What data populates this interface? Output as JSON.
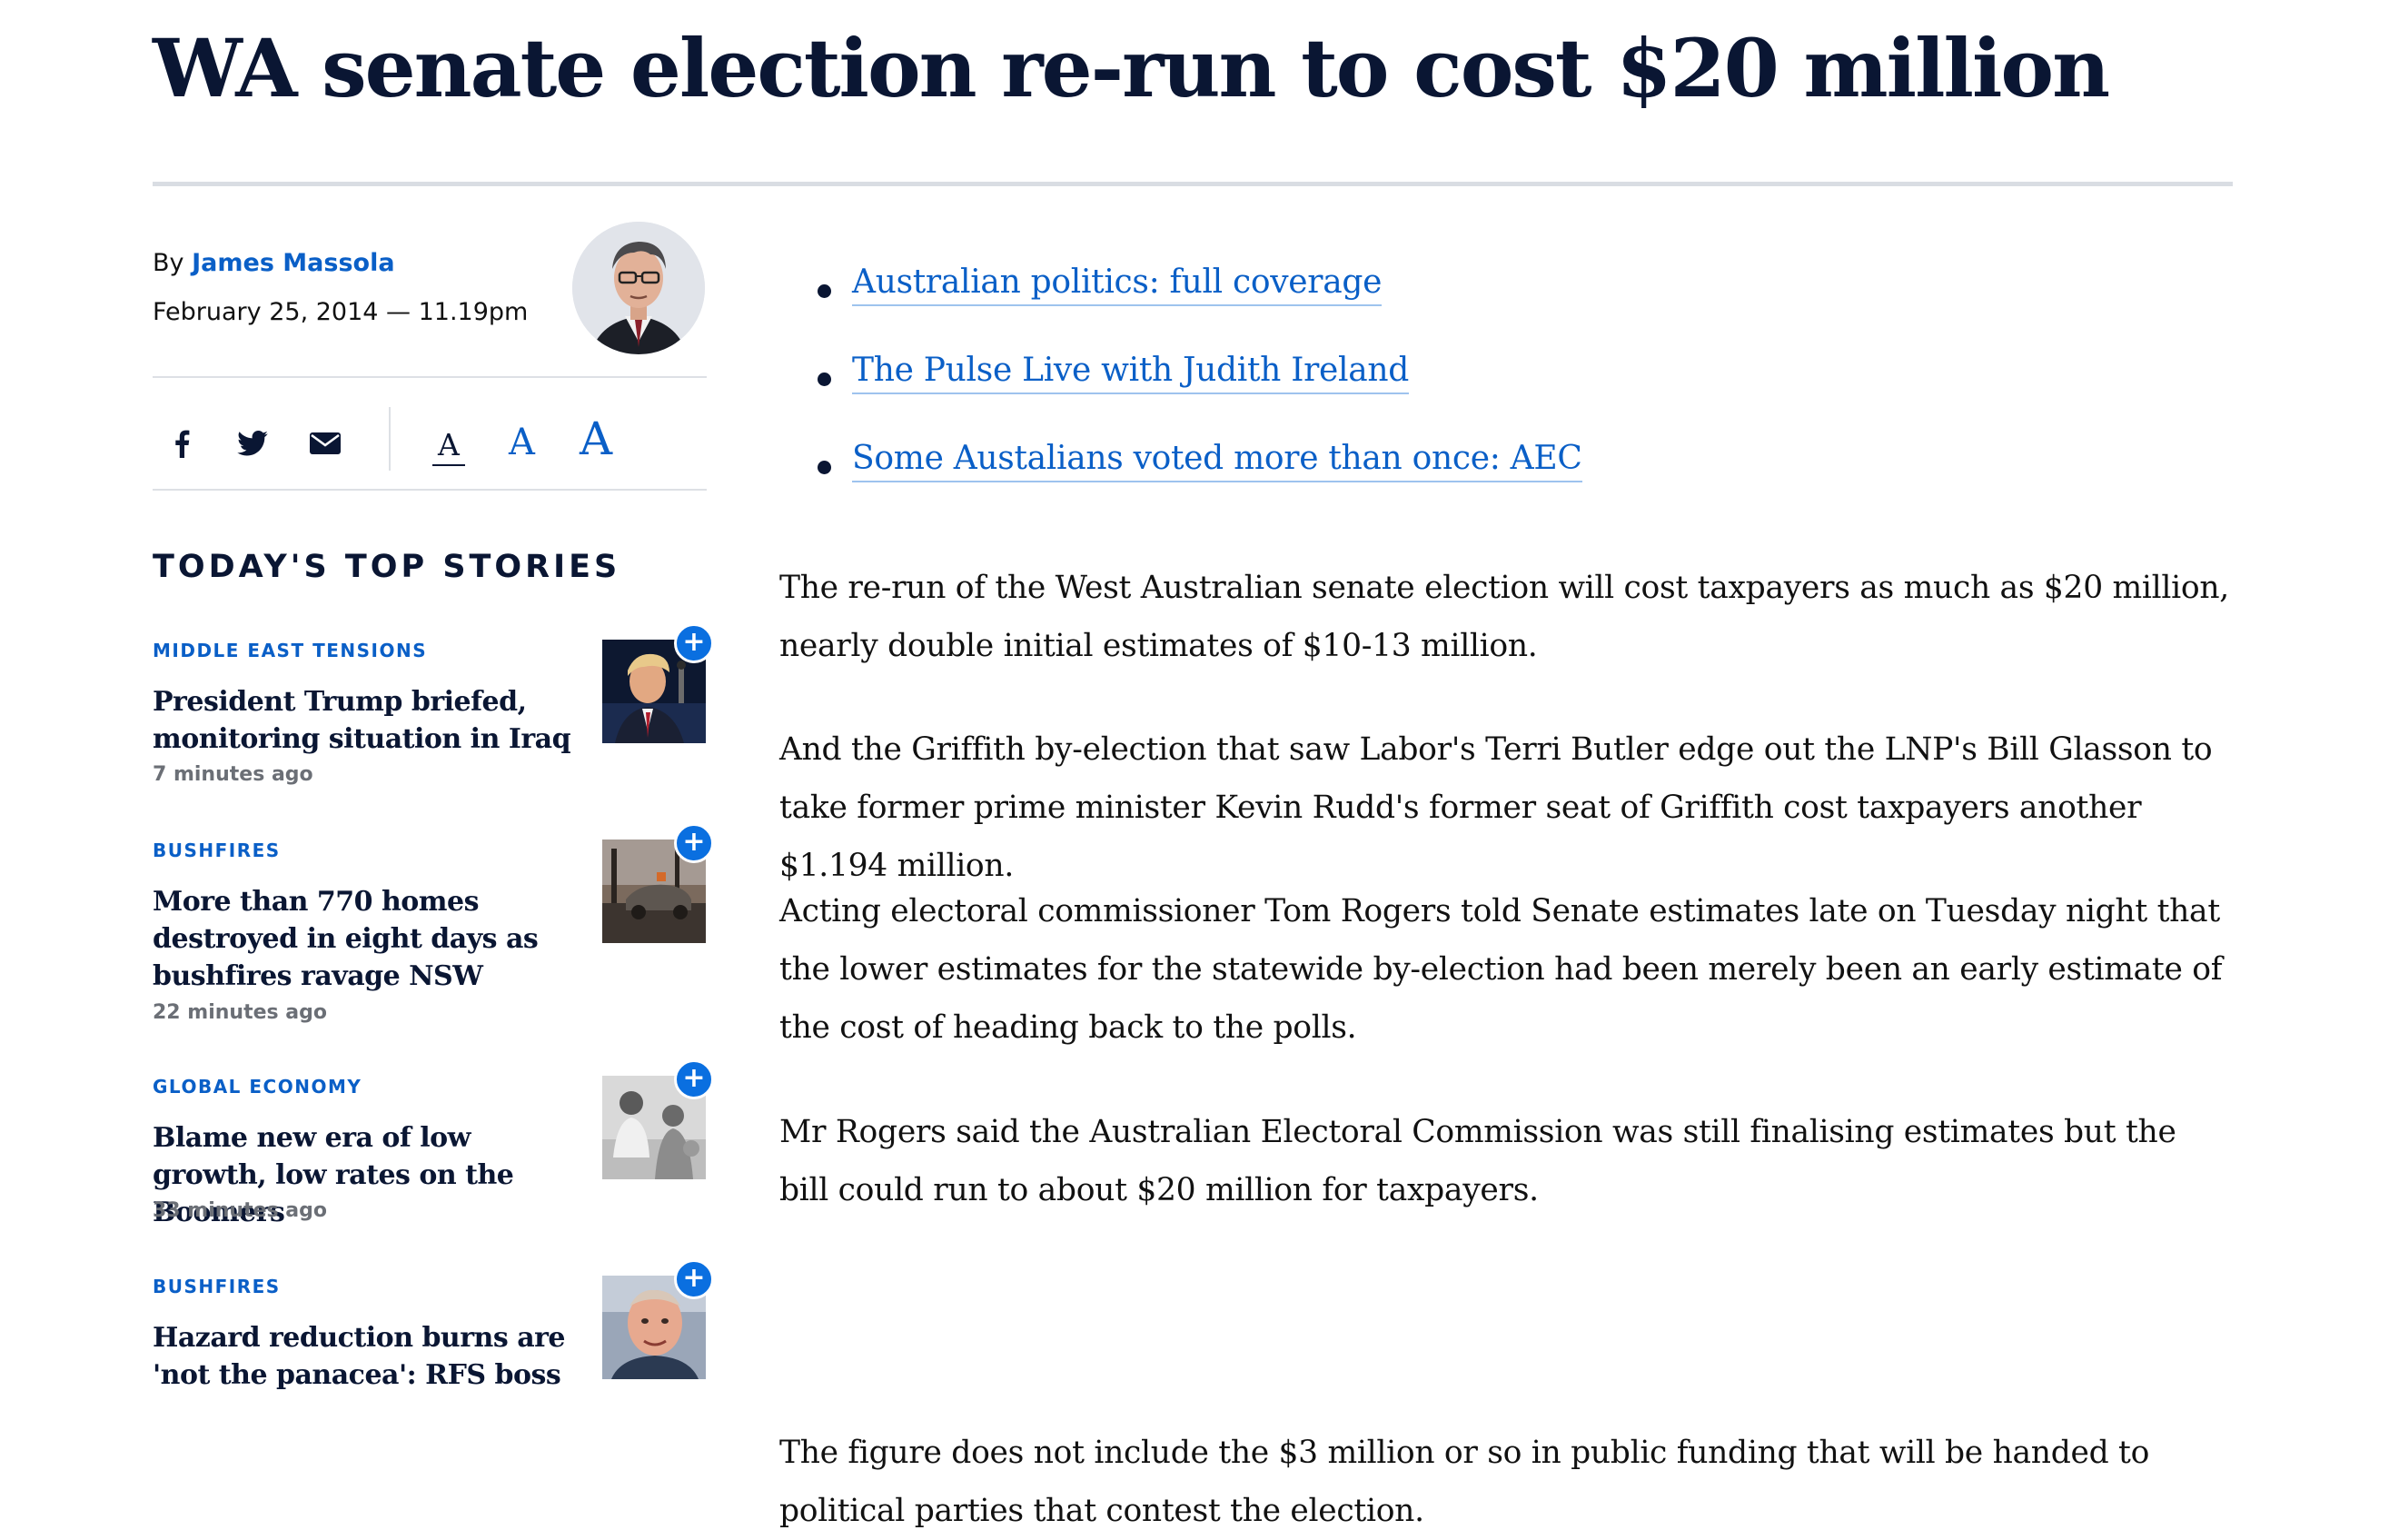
{
  "article": {
    "headline": "WA senate election re-run to cost $20 million",
    "byline_prefix": "By",
    "author": "James Massola",
    "date": "February 25, 2014 — 11.19pm",
    "related_links": [
      "Australian politics: full coverage",
      "The Pulse Live with Judith Ireland",
      "Some Austalians voted more than once: AEC"
    ],
    "paragraphs": [
      "The re-run of the West Australian senate election will cost taxpayers as much as $20 million, nearly double initial estimates of $10-13 million.",
      "And the Griffith by-election that saw Labor's Terri Butler edge out the LNP's Bill Glasson to take former prime minister Kevin Rudd's former seat of Griffith cost taxpayers another $1.194 million.",
      "Acting electoral commissioner Tom Rogers told Senate estimates late on Tuesday night that the lower estimates for the statewide by-election had been merely been an early estimate of the cost of heading back to the polls.",
      "Mr Rogers said the Australian Electoral Commission was still finalising estimates but the bill could run to about $20 million for taxpayers.",
      "The figure does not include the $3 million or so in public funding that will be handed to political parties that contest the election."
    ]
  },
  "share": {
    "icons": [
      "facebook-icon",
      "twitter-icon",
      "email-icon"
    ],
    "font_sizes": [
      "A",
      "A",
      "A"
    ]
  },
  "sidebar": {
    "top_stories_title": "TODAY'S TOP STORIES",
    "stories": [
      {
        "kicker": "MIDDLE EAST TENSIONS",
        "title": "President Trump briefed, monitoring situation in Iraq",
        "time": "7 minutes ago"
      },
      {
        "kicker": "BUSHFIRES",
        "title": "More than 770 homes destroyed in eight days as bushfires ravage NSW",
        "time": "22 minutes ago"
      },
      {
        "kicker": "GLOBAL ECONOMY",
        "title": "Blame new era of low growth, low rates on the Boomers",
        "time": "33 minutes ago"
      },
      {
        "kicker": "BUSHFIRES",
        "title": "Hazard reduction burns are 'not the panacea': RFS boss",
        "time": ""
      }
    ],
    "add_symbol": "+"
  },
  "colors": {
    "headline": "#0a1633",
    "link": "#0a5fc7",
    "rule": "#d9dde3",
    "add_button": "#0a6fe0"
  }
}
